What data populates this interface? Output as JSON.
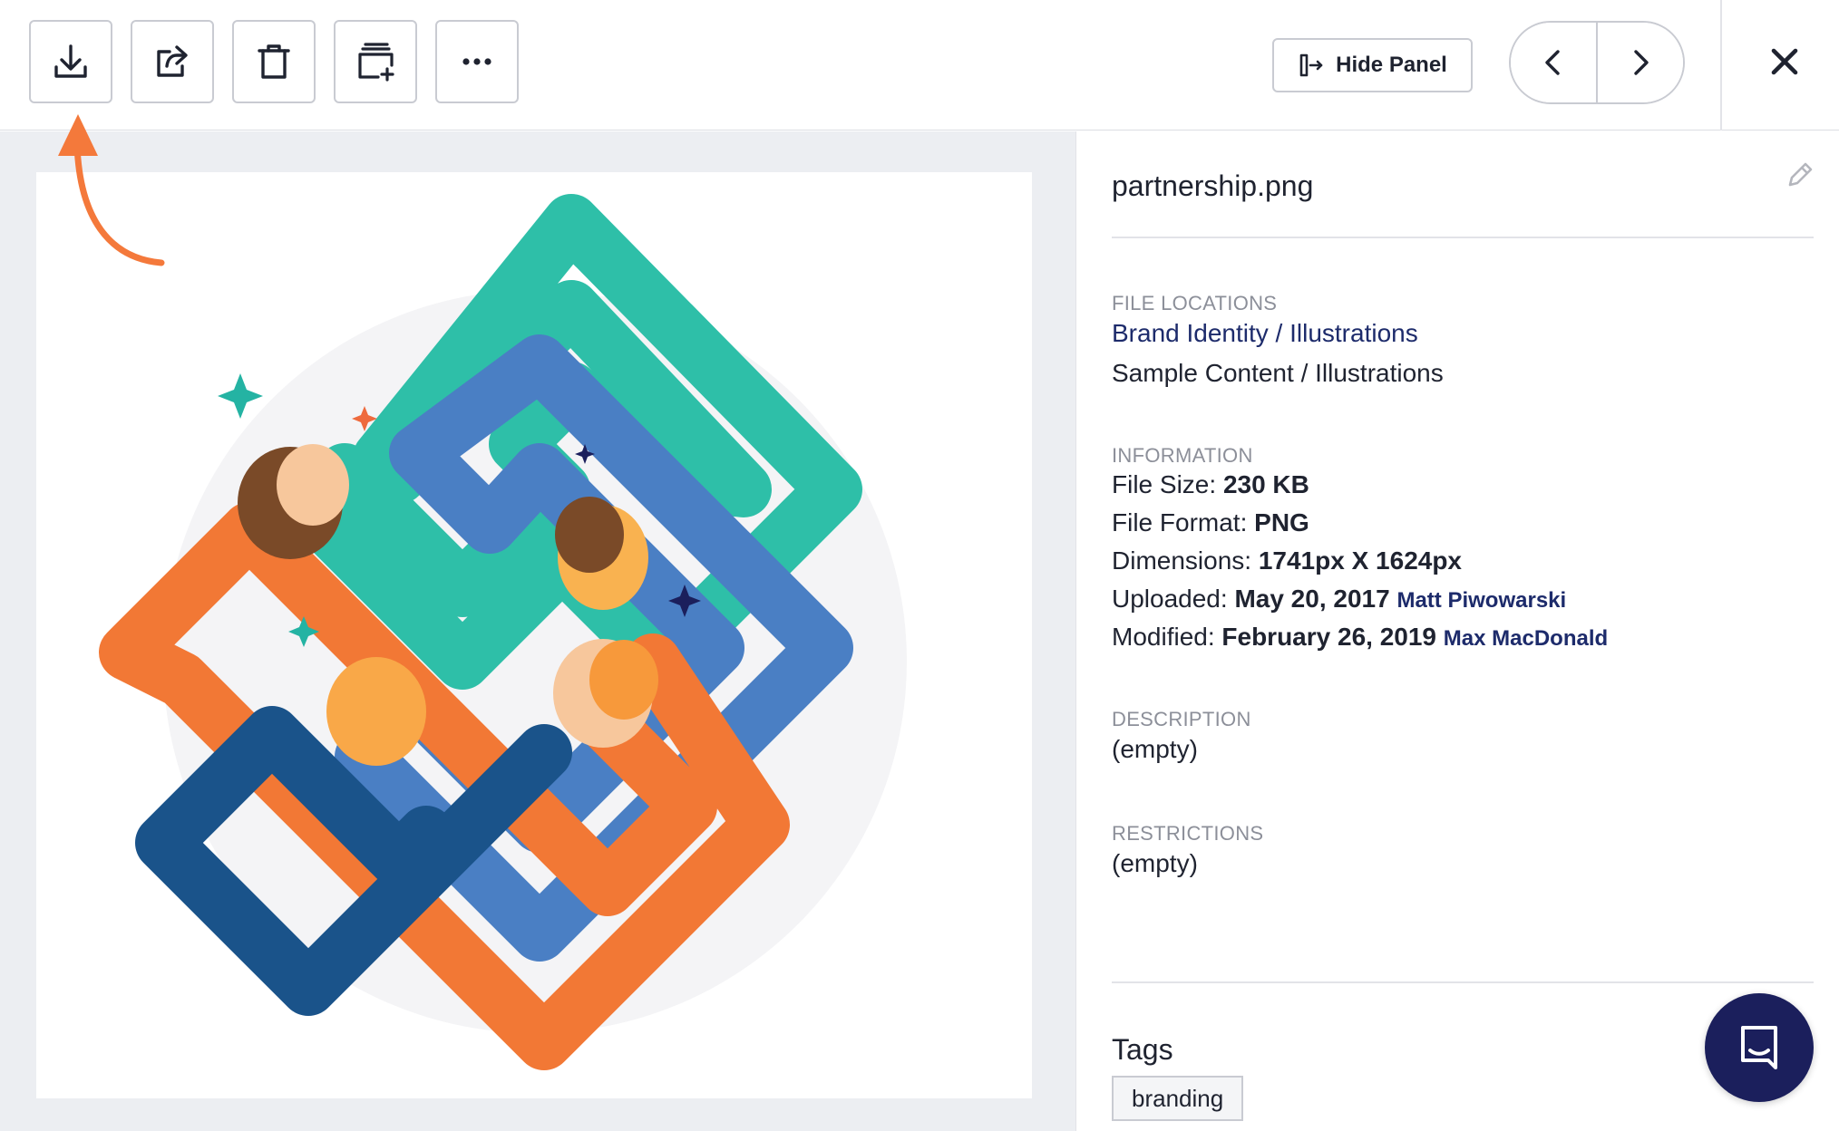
{
  "toolbar": {
    "buttons": [
      {
        "name": "download-button",
        "icon": "download-icon"
      },
      {
        "name": "share-button",
        "icon": "share-icon"
      },
      {
        "name": "delete-button",
        "icon": "trash-icon"
      },
      {
        "name": "add-to-collection-button",
        "icon": "add-to-collection-icon"
      },
      {
        "name": "more-options-button",
        "icon": "more-icon"
      }
    ],
    "hide_panel_label": "Hide Panel",
    "hide_panel_icon": "collapse-panel-icon",
    "prev_icon": "chevron-left-icon",
    "next_icon": "chevron-right-icon",
    "close_icon": "close-icon"
  },
  "preview": {
    "image_subject": "partnership illustration of four interlocking arms shaking hands",
    "hint_icon": "curved-arrow-icon",
    "hint_color": "#f4793b"
  },
  "details": {
    "file_name": "partnership.png",
    "edit_icon": "pencil-icon",
    "file_locations": {
      "label": "FILE LOCATIONS",
      "items": [
        "Brand Identity / Illustrations",
        "Sample Content / Illustrations"
      ]
    },
    "information": {
      "label": "INFORMATION",
      "file_size_label": "File Size:",
      "file_size": "230 KB",
      "file_format_label": "File Format:",
      "file_format": "PNG",
      "dimensions_label": "Dimensions:",
      "dimensions": "1741px X 1624px",
      "uploaded_label": "Uploaded:",
      "uploaded_date": "May 20, 2017",
      "uploaded_by": "Matt Piwowarski",
      "modified_label": "Modified:",
      "modified_date": "February 26, 2019",
      "modified_by": "Max MacDonald"
    },
    "description": {
      "label": "DESCRIPTION",
      "value": "(empty)"
    },
    "restrictions": {
      "label": "RESTRICTIONS",
      "value": "(empty)"
    },
    "tags": {
      "heading": "Tags",
      "items": [
        "branding"
      ]
    }
  },
  "chat": {
    "icon": "chat-icon",
    "color": "#1b1f5c"
  },
  "colors": {
    "accent_link": "#1d2b6b",
    "teal": "#2ebfa8",
    "blue": "#4a7fc4",
    "navy": "#1a538a",
    "orange": "#f27835"
  }
}
